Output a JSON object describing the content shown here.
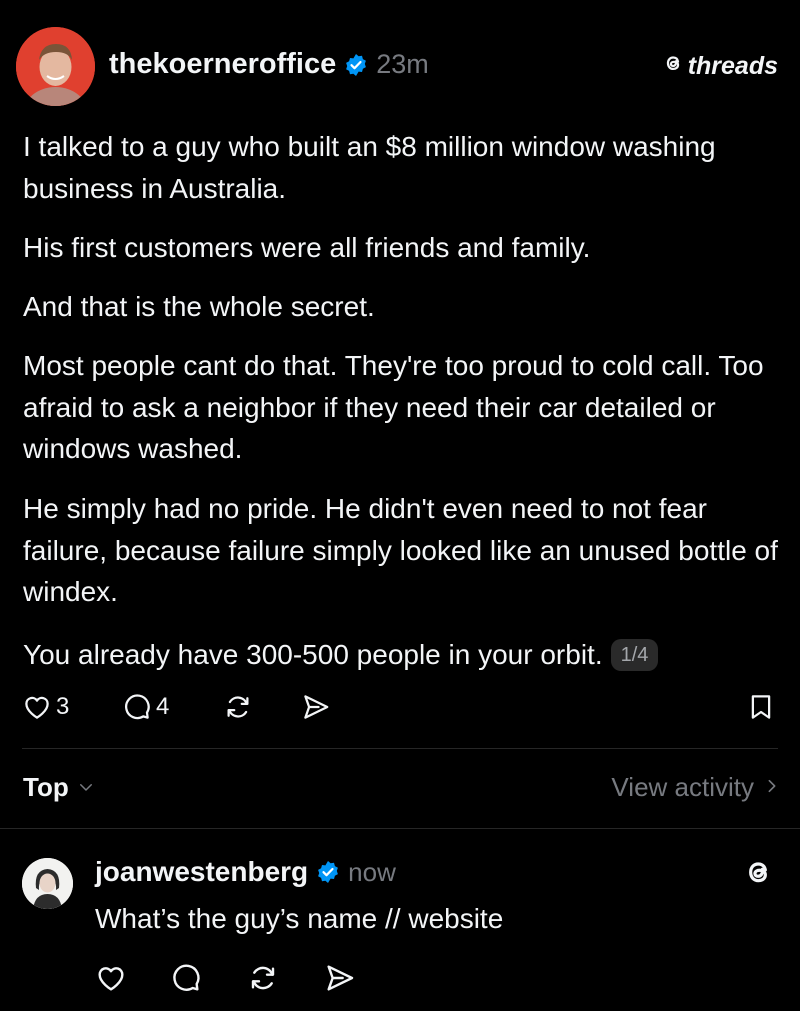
{
  "post": {
    "username": "thekoerneroffice",
    "time": "23m",
    "brand": "threads",
    "paragraphs": [
      "I talked to a guy who built an $8 million window washing business in Australia.",
      "His first customers were all friends and family.",
      "And that is the whole secret.",
      "Most people cant do that. They're too proud to cold call. Too afraid to ask a neighbor if they need their car detailed or windows washed.",
      "He simply had no pride. He didn't even need to not fear failure, because failure simply looked like an unused bottle of windex.",
      "You already have 300-500 people in your orbit."
    ],
    "page_indicator": "1/4",
    "likes": "3",
    "replies": "4"
  },
  "filter": {
    "sort_label": "Top",
    "view_activity_label": "View activity"
  },
  "reply": {
    "username": "joanwestenberg",
    "time": "now",
    "text": "What’s the guy’s name // website"
  },
  "colors": {
    "background": "#000000",
    "text": "#f3f5f7",
    "muted": "#777a80",
    "verified": "#0095f6",
    "avatar_bg": "#e0402f"
  },
  "icons": [
    "heart-icon",
    "comment-icon",
    "repost-icon",
    "share-icon",
    "bookmark-icon",
    "chevron-down-icon",
    "chevron-right-icon",
    "threads-logo-icon",
    "verified-badge-icon"
  ]
}
